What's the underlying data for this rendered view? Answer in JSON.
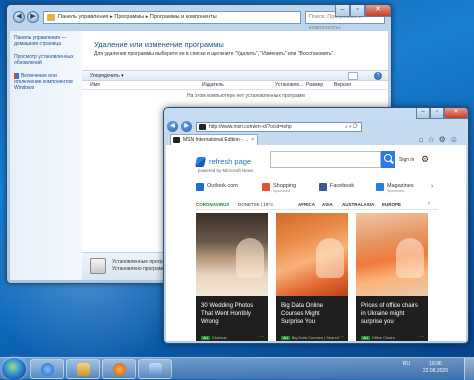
{
  "control_panel": {
    "address_path": [
      "Панель управления",
      "Программы",
      "Программы и компоненты"
    ],
    "search_placeholder": "Поиск: Программы и компоненты",
    "sidebar": [
      {
        "label": "Панель управления — домашняя страница"
      },
      {
        "label": "Просмотр установленных обновлений"
      },
      {
        "label": "Включение или отключение компонентов Windows"
      }
    ],
    "heading": "Удаление или изменение программы",
    "description": "Для удаления программы выберите ее в списке и щелкните \"Удалить\", \"Изменить\" или \"Восстановить\".",
    "toolbar": {
      "organize": "Упорядочить ▾"
    },
    "columns": [
      "Имя",
      "Издатель",
      "Установле...",
      "Размер",
      "Версия"
    ],
    "empty_message": "На этом компьютере нет установленных программ",
    "status": {
      "title": "Установленные программы",
      "subtitle": "Установлено программ: 0"
    }
  },
  "browser": {
    "url": "http://www.msn.com/en-xl/?ocid=iehp",
    "tab_title": "MSN International Edition - ...",
    "msn": {
      "logo_text": "refresh page",
      "logo_sub": "powered by Microsoft News",
      "signin": "Sign in",
      "quick_links": [
        {
          "label": "Outlook.com",
          "sub": "",
          "icon": "outlook-icon",
          "color": "#1d6fc9"
        },
        {
          "label": "Shopping",
          "sub": "Sponsored",
          "icon": "shopping-icon",
          "color": "#e8532b"
        },
        {
          "label": "Facebook",
          "sub": "",
          "icon": "facebook-icon",
          "color": "#3b5998"
        },
        {
          "label": "Magazines",
          "sub": "Sponsored",
          "icon": "magazines-icon",
          "color": "#2a7bde"
        }
      ],
      "topics": {
        "coronavirus": "CORONAVIRUS",
        "weather": "DONETSK | 19°C",
        "items": [
          "AFRICA",
          "ASIA",
          "AUSTRALASIA",
          "EUROPE"
        ]
      },
      "cards": [
        {
          "title": "30 Wedding Photos That Went Horribly Wrong",
          "source": "Glorious",
          "ad": "Ad"
        },
        {
          "title": "Big Data Online Courses Might Surprise You",
          "source": "Big Data Courses | Search",
          "ad": "Ad"
        },
        {
          "title": "Prices of office chairs in Ukraine might surprise you",
          "source": "Office Chairs",
          "ad": "Ad"
        }
      ]
    }
  },
  "taskbar": {
    "tray_lang": "RU",
    "time": "10:36",
    "date": "22.08.2020"
  }
}
